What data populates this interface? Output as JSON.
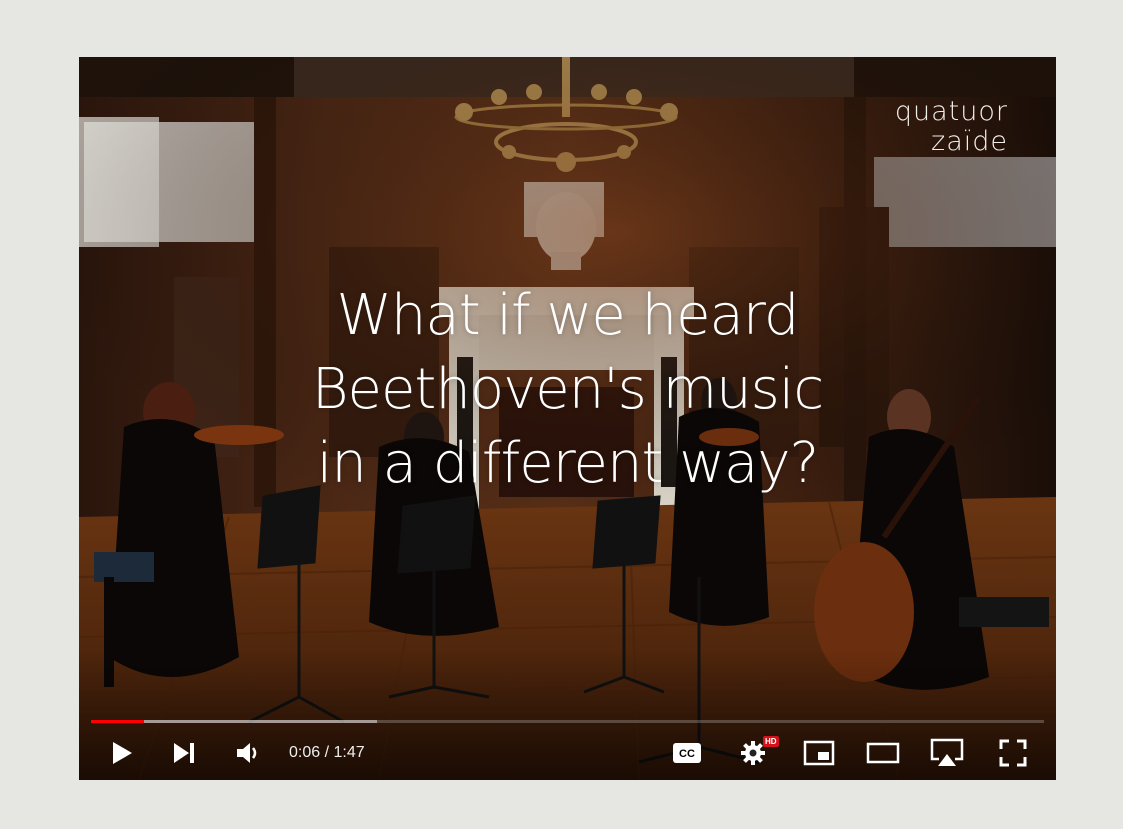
{
  "video": {
    "logo_line1": "quatuor",
    "logo_line2": "zaïde",
    "headline": [
      "What if we heard",
      "Beethoven's music",
      "in a different way?"
    ]
  },
  "player": {
    "current_time": "0:06",
    "duration": "1:47",
    "time_display": "0:06 / 1:47",
    "played_fraction": 0.056,
    "buffered_fraction": 0.3,
    "settings_badge": "HD",
    "colors": {
      "progress_played": "#ff0000",
      "hd_badge": "#d3121b"
    }
  },
  "icons": [
    "play-icon",
    "next-icon",
    "volume-icon",
    "subtitles-icon",
    "settings-icon",
    "miniplayer-icon",
    "theater-mode-icon",
    "airplay-icon",
    "fullscreen-icon"
  ]
}
